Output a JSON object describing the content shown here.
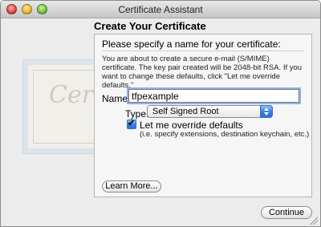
{
  "window": {
    "title": "Certificate Assistant"
  },
  "illustration": {
    "script_text": "Certif",
    "icon": "certificate-illustration"
  },
  "heading": "Create Your Certificate",
  "panel": {
    "prompt": "Please specify a name for your certificate:",
    "info": "You are about to create a secure e-mail (S/MIME) certificate. The key pair created will be 2048-bit RSA. If you want to change these defaults, click \"Let me override defaults.\"",
    "name_label": "Name:",
    "name_value": "tfpexample",
    "type_label": "Type:",
    "type_value": "Self Signed Root",
    "override_label": "Let me override defaults",
    "override_checked": true,
    "override_hint": "(i.e. specify extensions, destination keychain, etc.)",
    "learn_more": "Learn More..."
  },
  "footer": {
    "continue": "Continue"
  },
  "colors": {
    "accent": "#3d7fe0",
    "focus_ring": "#8cb4e6"
  }
}
